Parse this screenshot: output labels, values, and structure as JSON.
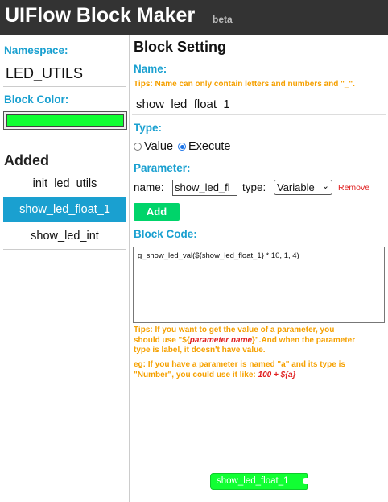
{
  "header": {
    "title": "UIFlow Block Maker",
    "badge": "beta"
  },
  "sidebar": {
    "namespace_label": "Namespace:",
    "namespace_value": "LED_UTILS",
    "block_color_label": "Block Color:",
    "block_color": "#11ff33",
    "added_title": "Added",
    "items": [
      {
        "label": "init_led_utils",
        "active": false
      },
      {
        "label": "show_led_float_1",
        "active": true
      },
      {
        "label": "show_led_int",
        "active": false
      }
    ]
  },
  "main": {
    "heading": "Block Setting",
    "name_label": "Name:",
    "name_tip": "Tips: Name can only contain letters and numbers and \"_\".",
    "name_value": "show_led_float_1",
    "type_label": "Type:",
    "type_options": [
      {
        "label": "Value",
        "checked": false
      },
      {
        "label": "Execute",
        "checked": true
      }
    ],
    "parameter_label": "Parameter:",
    "param_name_label": "name:",
    "param_name_value": "show_led_fl",
    "param_type_label": "type:",
    "param_type_value": "Variable",
    "remove_label": "Remove",
    "add_label": "Add",
    "code_label": "Block Code:",
    "code_value": "g_show_led_val(${show_led_float_1} * 10, 1, 4)",
    "code_tip": {
      "line1": "Tips: If you want to get the value of a parameter, you",
      "line2_pre": "should use \"${",
      "line2_em": "parameter name",
      "line2_post": "}\".And when the parameter",
      "line3": "type is label, it doesn't have value."
    },
    "example_tip": {
      "line1": "eg: If you have a parameter is named \"a\" and its type is",
      "line2_pre": "\"Number\", you could use it like: ",
      "line2_em": "100 + ${a}"
    }
  },
  "preview": {
    "block_label": "show_led_float_1",
    "block_color": "#11ff33"
  }
}
